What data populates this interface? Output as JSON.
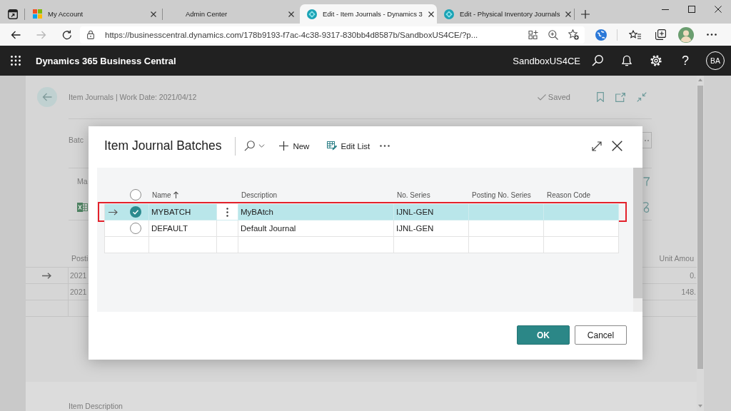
{
  "browser": {
    "tabs": [
      {
        "title": "My Account",
        "kind": "squares",
        "selected": false
      },
      {
        "title": "Admin Center",
        "kind": "plain",
        "selected": false
      },
      {
        "title": "Edit - Item Journals - Dynamics 3",
        "kind": "round",
        "selected": true
      },
      {
        "title": "Edit - Physical Inventory Journals",
        "kind": "round",
        "selected": false
      }
    ],
    "address": {
      "url": "https://businesscentral.dynamics.com/178b9193-f7ac-4c38-9317-830bb4d8587b/SandboxUS4CE/?p..."
    },
    "forward_disabled": true
  },
  "app_bar": {
    "product": "Dynamics 365 Business Central",
    "environment": "SandboxUS4CE",
    "help": "?",
    "user_initials": "BA"
  },
  "page": {
    "caption": "Item Journals | Work Date: 2021/04/12",
    "save_status": "Saved",
    "batch_label": "Batc",
    "action_tab": "Ma",
    "table": {
      "columns": [
        "Posti",
        "Unit Amou"
      ],
      "rows": [
        {
          "current": true,
          "cells": [
            "2021",
            "0."
          ]
        },
        {
          "current": false,
          "cells": [
            "2021",
            "148."
          ]
        }
      ]
    },
    "section_title": "Item Description"
  },
  "dialog": {
    "title": "Item Journal Batches",
    "actions": [
      {
        "kind": "search"
      },
      {
        "kind": "new",
        "label": "New"
      },
      {
        "kind": "edit-list",
        "label": "Edit List"
      },
      {
        "kind": "more"
      }
    ],
    "select_all_checked": false,
    "columns": [
      {
        "label": "Name",
        "sorted": true
      },
      {
        "label": "Description",
        "sorted": false
      },
      {
        "label": "No. Series",
        "sorted": false
      },
      {
        "label": "Posting No. Series",
        "sorted": false
      },
      {
        "label": "Reason Code",
        "sorted": false
      }
    ],
    "rows": [
      {
        "name": "MYBATCH",
        "description": "MyBAtch",
        "no_series": "IJNL-GEN",
        "selected": true,
        "outlined": true
      },
      {
        "name": "DEFAULT",
        "description": "Default Journal",
        "no_series": "IJNL-GEN",
        "selected": false,
        "outlined": false
      }
    ],
    "buttons": [
      {
        "kind": "primary",
        "label": "OK"
      },
      {
        "kind": "secondary",
        "label": "Cancel"
      }
    ]
  }
}
